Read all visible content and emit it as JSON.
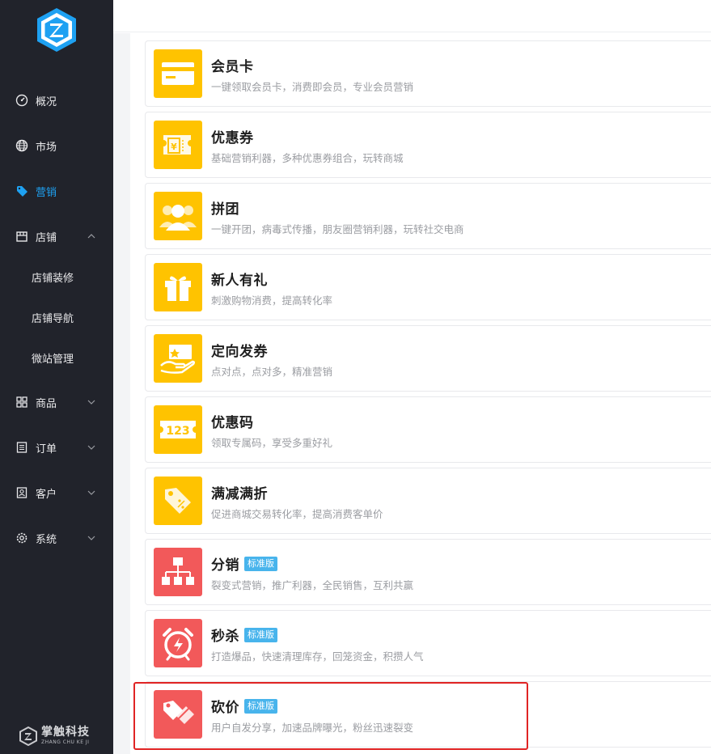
{
  "sidebar": {
    "logo_icon": "shield-z-logo",
    "nav": [
      {
        "label": "概况",
        "icon": "dashboard-icon"
      },
      {
        "label": "市场",
        "icon": "globe-icon"
      },
      {
        "label": "营销",
        "icon": "tag-icon",
        "active": true
      },
      {
        "label": "店铺",
        "icon": "store-icon"
      },
      {
        "label": "商品",
        "icon": "grid-icon"
      },
      {
        "label": "订单",
        "icon": "list-icon"
      },
      {
        "label": "客户",
        "icon": "contact-icon"
      },
      {
        "label": "系统",
        "icon": "gear-icon"
      }
    ],
    "sub": [
      "店铺装修",
      "店铺导航",
      "微站管理"
    ],
    "brand_cn": "掌触科技",
    "brand_en": "ZHANG CHU KE JI",
    "active_color": "#1ea1f2",
    "bg_color": "#21232b"
  },
  "cards": [
    {
      "title": "会员卡",
      "desc": "一键领取会员卡，消费即会员，专业会员营销",
      "icon": "card-icon",
      "color": "yellow"
    },
    {
      "title": "优惠券",
      "desc": "基础营销利器，多种优惠券组合，玩转商城",
      "icon": "coupon-icon",
      "color": "yellow"
    },
    {
      "title": "拼团",
      "desc": "一键开团，病毒式传播，朋友圈营销利器，玩转社交电商",
      "icon": "group-icon",
      "color": "yellow"
    },
    {
      "title": "新人有礼",
      "desc": "刺激购物消费，提高转化率",
      "icon": "gift-icon",
      "color": "yellow"
    },
    {
      "title": "定向发券",
      "desc": "点对点，点对多，精准营销",
      "icon": "hand-coupon-icon",
      "color": "yellow"
    },
    {
      "title": "优惠码",
      "desc": "领取专属码，享受多重好礼",
      "icon": "code-123-icon",
      "color": "yellow"
    },
    {
      "title": "满减满折",
      "desc": "促进商城交易转化率，提高消费客单价",
      "icon": "discount-tag-icon",
      "color": "yellow"
    },
    {
      "title": "分销",
      "badge": "标准版",
      "desc": "裂变式营销，推广利器，全民销售，互利共赢",
      "icon": "hierarchy-icon",
      "color": "red"
    },
    {
      "title": "秒杀",
      "badge": "标准版",
      "desc": "打造爆品，快速清理库存，回笼资金，积攒人气",
      "icon": "alarm-clock-icon",
      "color": "red"
    },
    {
      "title": "砍价",
      "badge": "标准版",
      "desc": "用户自发分享，加速品牌曝光，粉丝迅速裂变",
      "icon": "cut-tag-icon",
      "color": "red"
    }
  ],
  "colors": {
    "yellow": "#ffc300",
    "red": "#f2595a",
    "badge": "#48b4ec",
    "highlight": "#e02424"
  }
}
